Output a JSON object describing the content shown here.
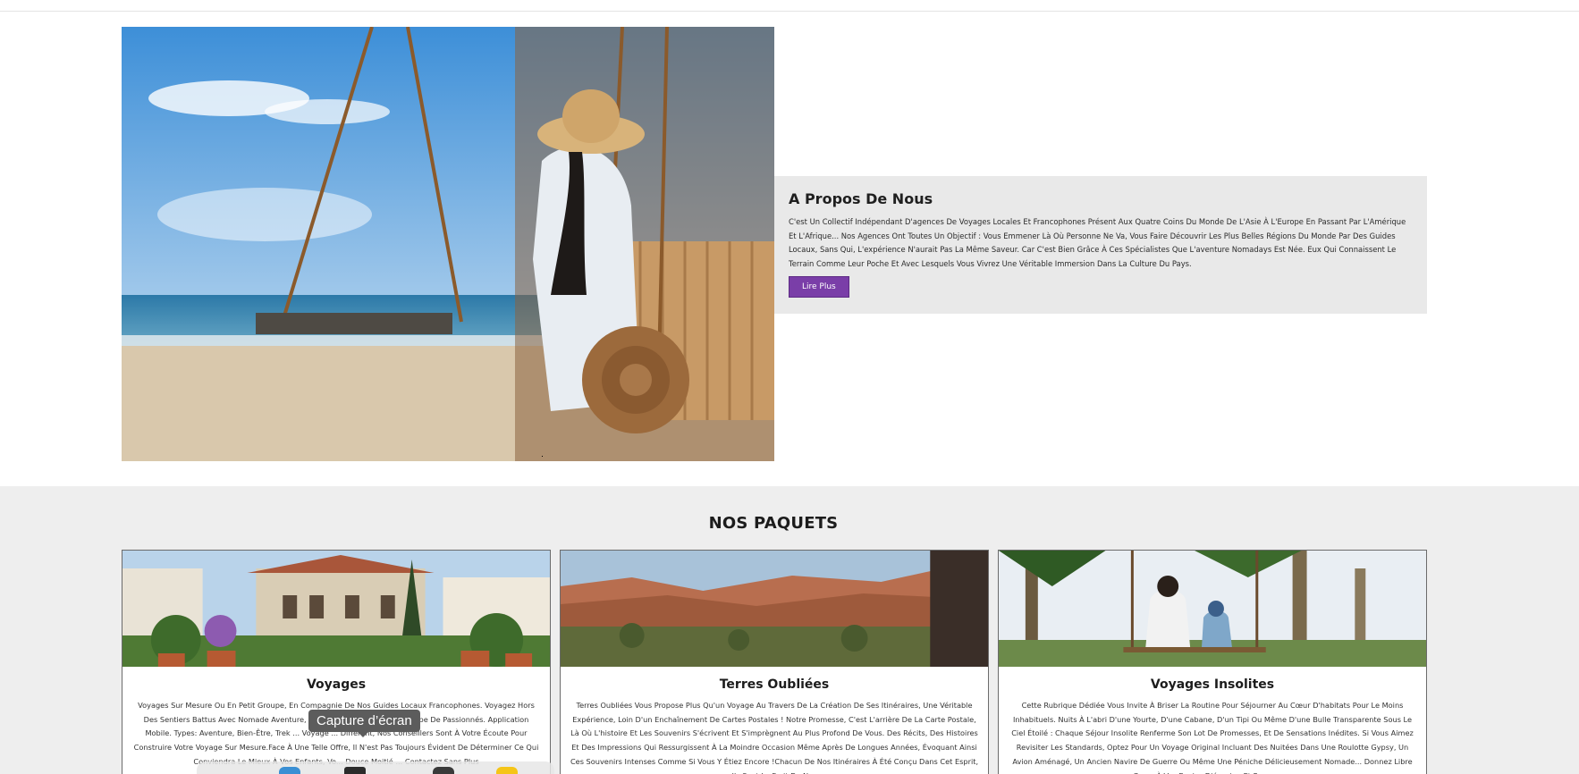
{
  "about": {
    "title": "A Propos De Nous",
    "text": "C'est Un Collectif Indépendant D'agences De Voyages Locales Et Francophones Présent Aux Quatre Coins Du Monde De L'Asie À L'Europe En Passant Par L'Amérique Et L'Afrique... Nos Agences Ont Toutes Un Objectif : Vous Emmener Là Où Personne Ne Va, Vous Faire Découvrir Les Plus Belles Régions Du Monde Par Des Guides Locaux, Sans Qui, L'expérience N'aurait Pas La Même Saveur. Car C'est Bien Grâce À Ces Spécialistes Que L'aventure Nomadays Est Née. Eux Qui Connaissent Le Terrain Comme Leur Poche Et Avec Lesquels Vous Vivrez Une Véritable Immersion Dans La Culture Du Pays.",
    "button": "Lire Plus",
    "button_color": "#7a3ea8"
  },
  "packages": {
    "title": "NOS PAQUETS",
    "cards": [
      {
        "title": "Voyages",
        "text": "Voyages Sur Mesure Ou En Petit Groupe, En Compagnie De Nos Guides Locaux Francophones. Voyagez Hors Des Sentiers Battus Avec Nomade Aventure, Plus De ... Expérimentés. Équipe De Passionnés. Application Mobile. Types: Aventure, Bien-Être, Trek ... Voyage ... Différent, Nos Conseillers Sont À Votre Écoute Pour Construire Votre Voyage Sur Mesure.Face À Une Telle Offre, Il N'est Pas Toujours Évident De Déterminer Ce Qui Conviendra Le Mieux À Vos Enfants, Vo... Douce Moitié ... Contactez Sans Plus"
      },
      {
        "title": "Terres Oubliées",
        "text": "Terres Oubliées Vous Propose Plus Qu'un Voyage Au Travers De La Création De Ses Itinéraires, Une Véritable Expérience, Loin D'un Enchaînement De Cartes Postales ! Notre Promesse, C'est L'arrière De La Carte Postale, Là Où L'histoire Et Les Souvenirs S'écrivent Et S'imprègnent Au Plus Profond De Vous. Des Récits, Des Histoires Et Des Impressions Qui Ressurgissent À La Moindre Occasion Même Après De Longues Années, Évoquant Ainsi Ces Souvenirs Intenses Comme Si Vous Y Étiez Encore !Chacun De Nos Itinéraires À Été Conçu Dans Cet Esprit, Ils Sont Le Fruit De Nos"
      },
      {
        "title": "Voyages Insolites",
        "text": "Cette Rubrique Dédiée Vous Invite À Briser La Routine Pour Séjourner Au Cœur D'habitats Pour Le Moins Inhabituels. Nuits À L'abri D'une Yourte, D'une Cabane, D'un Tipi Ou Même D'une Bulle Transparente Sous Le Ciel Étoilé : Chaque Séjour Insolite Renferme Son Lot De Promesses, Et De Sensations Inédites. Si Vous Aimez Revisiter Les Standards, Optez Pour Un Voyage Original Incluant Des Nuitées Dans Une Roulotte Gypsy, Un Avion Aménagé, Un Ancien Navire De Guerre Ou Même Une Péniche Délicieusement Nomade... Donnez Libre Cours À Vos Envies D'évasion Et Parcourrez"
      }
    ]
  },
  "overlay": {
    "tooltip": "Capture d’écran"
  }
}
